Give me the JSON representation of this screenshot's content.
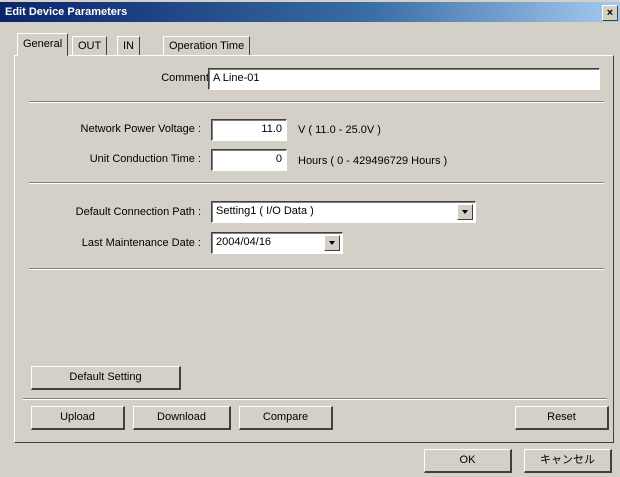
{
  "window": {
    "title": "Edit Device Parameters",
    "close_label": "×"
  },
  "tabs": [
    {
      "label": "General",
      "active": true
    },
    {
      "label": "OUT"
    },
    {
      "label": "IN"
    },
    {
      "label": "Operation Time"
    }
  ],
  "general": {
    "comment_label": "Comment :",
    "comment_value": "A  Line-01",
    "network_voltage_label": "Network Power Voltage :",
    "network_voltage_value": "11.0",
    "network_voltage_unit": "V ( 11.0 - 25.0V )",
    "conduction_time_label": "Unit Conduction Time :",
    "conduction_time_value": "0",
    "conduction_time_unit": "Hours ( 0 - 429496729 Hours )",
    "connection_path_label": "Default Connection Path :",
    "connection_path_value": "Setting1 ( I/O Data )",
    "maintenance_date_label": "Last Maintenance Date :",
    "maintenance_date_value": "2004/04/16",
    "default_setting_button": "Default Setting"
  },
  "actions": {
    "upload": "Upload",
    "download": "Download",
    "compare": "Compare",
    "reset": "Reset"
  },
  "dialog_buttons": {
    "ok": "OK",
    "cancel": "キャンセル"
  }
}
